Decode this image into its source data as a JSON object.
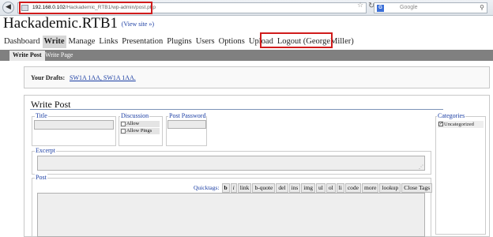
{
  "browser": {
    "back_icon": "back-arrow-icon",
    "url_host": "192.168.0.102",
    "url_path": "/Hackademic_RTB1/wp-admin/post.php",
    "search_engine_letter": "G",
    "search_placeholder": "Google",
    "highlight_color": "#d01c1c"
  },
  "header": {
    "site_title": "Hackademic.RTB1",
    "view_site": "(View site »)"
  },
  "menu": {
    "items": [
      "Dashboard",
      "Write",
      "Manage",
      "Links",
      "Presentation",
      "Plugins",
      "Users",
      "Options",
      "Upload",
      "Logout (GeorgeMiller)"
    ],
    "active": "Write"
  },
  "subnav": {
    "write_post": "Write Post",
    "write_page": "Write Page"
  },
  "drafts": {
    "label": "Your Drafts:",
    "links": "SW1A 1AA, SW1A 1AA."
  },
  "write_post": {
    "heading": "Write Post",
    "title_label": "Title",
    "discussion_label": "Discussion",
    "allow_comments": "Allow Comments",
    "allow_pings": "Allow Pings",
    "password_label": "Post Password",
    "excerpt_label": "Excerpt",
    "post_label": "Post",
    "quicktags_label": "Quicktags:",
    "quicktags": [
      "b",
      "i",
      "link",
      "b-quote",
      "del",
      "ins",
      "img",
      "ul",
      "ol",
      "li",
      "code",
      "more",
      "lookup",
      "Close Tags"
    ]
  },
  "categories": {
    "label": "Categories",
    "items": [
      "Uncategorized"
    ]
  }
}
